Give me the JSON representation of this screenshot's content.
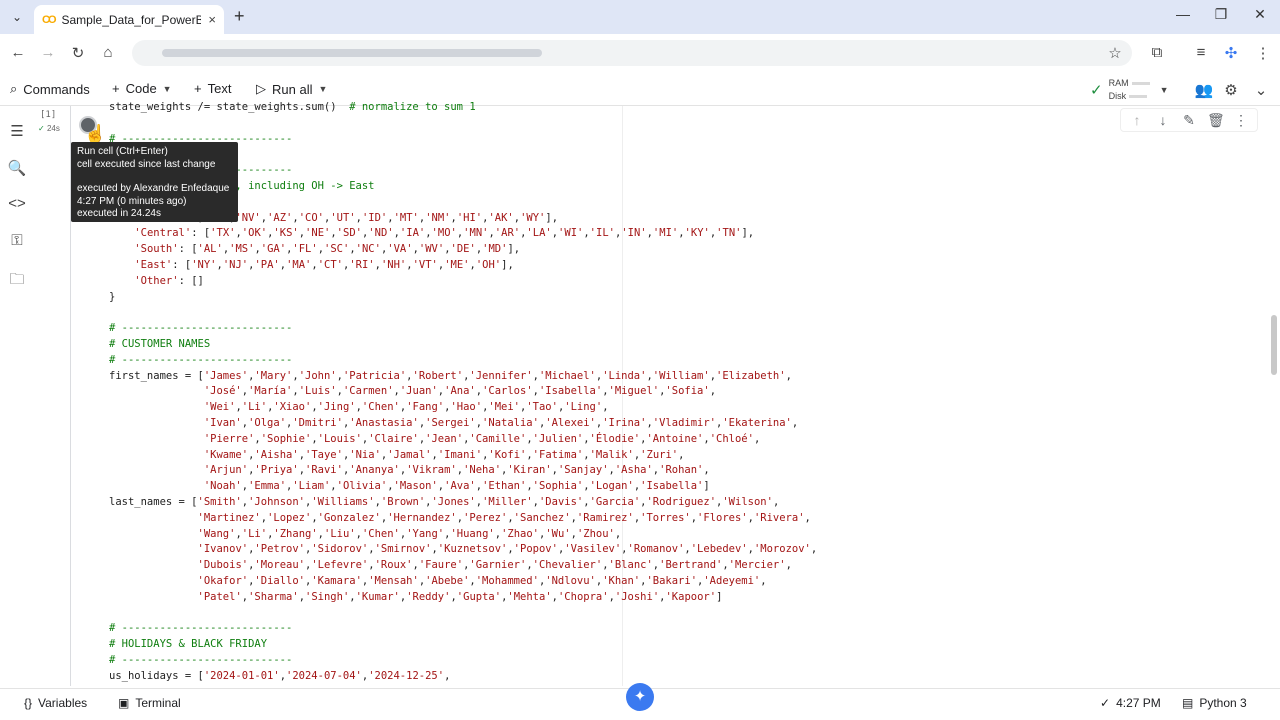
{
  "browser": {
    "tab_title": "Sample_Data_for_PowerBI_MVP",
    "tab_close": "×",
    "new_tab": "+",
    "minimize": "—",
    "restore": "❐",
    "close": "✕"
  },
  "colab_toolbar": {
    "commands": "Commands",
    "code": "Code",
    "text": "Text",
    "run_all": "Run all",
    "ram": "RAM",
    "disk": "Disk"
  },
  "cell": {
    "exec_count": "[1]",
    "exec_time": "24s",
    "tooltip": {
      "line1": "Run cell (Ctrl+Enter)",
      "line2": "cell executed since last change",
      "line3": "executed by Alexandre Enfedaque",
      "line4": "4:27 PM (0 minutes ago)",
      "line5": "executed in 24.24s"
    }
  },
  "statusbar": {
    "variables": "Variables",
    "terminal": "Terminal",
    "time": "4:27 PM",
    "kernel": "Python 3"
  },
  "icons": [
    "dropdown-icon",
    "colab-logo",
    "back-icon",
    "forward-icon",
    "reload-icon",
    "home-icon",
    "star-icon",
    "extensions-icon",
    "cast-icon",
    "toc-icon",
    "search-icon",
    "code-icon",
    "key-icon",
    "folder-icon",
    "run-icon",
    "arrow-up-icon",
    "arrow-down-icon",
    "edit-icon",
    "delete-icon",
    "more-icon",
    "gemini-icon",
    "check-icon",
    "people-icon",
    "gear-icon"
  ]
}
